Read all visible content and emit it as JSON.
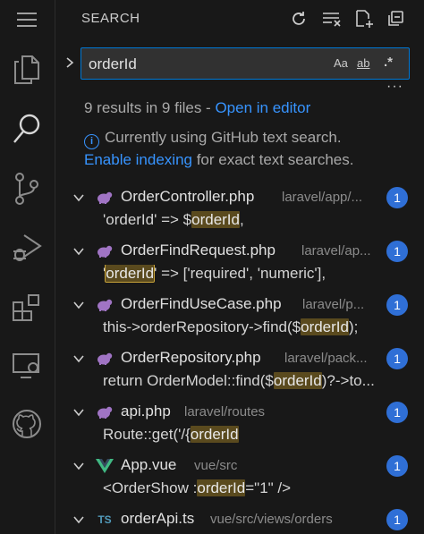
{
  "activity_bar": {
    "items": [
      {
        "name": "explorer",
        "icon": "files-icon"
      },
      {
        "name": "search",
        "icon": "search-icon",
        "active": true
      },
      {
        "name": "source-control",
        "icon": "source-control-icon"
      },
      {
        "name": "run-debug",
        "icon": "run-debug-icon"
      },
      {
        "name": "extensions",
        "icon": "extensions-icon"
      },
      {
        "name": "remote-explorer",
        "icon": "remote-explorer-icon"
      },
      {
        "name": "github",
        "icon": "github-icon"
      }
    ]
  },
  "header": {
    "title": "SEARCH",
    "actions": [
      "refresh-icon",
      "clear-results-icon",
      "new-search-editor-icon",
      "collapse-all-icon"
    ]
  },
  "search": {
    "value": "orderId",
    "options": {
      "match_case": "Aa",
      "whole_word": "ab",
      "regex": ".*"
    }
  },
  "summary": {
    "count_text": "9 results in 9 files - ",
    "open_in_editor": "Open in editor"
  },
  "info": {
    "line1": "Currently using GitHub text search.",
    "enable_indexing": "Enable indexing",
    "line2_rest": " for exact text searches."
  },
  "colors": {
    "accent": "#3794ff",
    "badge": "#2f6fd6",
    "php": "#a074c4",
    "vue": "#41b883",
    "ts": "#519aba",
    "match_highlight": "#5a4a1e"
  },
  "results": [
    {
      "file": "OrderController.php",
      "path": "laravel/app/...",
      "count": "1",
      "type": "php",
      "match": {
        "before": "'orderId' => $",
        "hit": "orderId",
        "after": ","
      }
    },
    {
      "file": "OrderFindRequest.php",
      "path": "laravel/ap...",
      "count": "1",
      "type": "php",
      "match": {
        "before": "'",
        "hit": "orderId",
        "after": "' => ['required', 'numeric'],"
      }
    },
    {
      "file": "OrderFindUseCase.php",
      "path": "laravel/p...",
      "count": "1",
      "type": "php",
      "match": {
        "before": "this->orderRepository->find($",
        "hit": "orderId",
        "after": ");"
      }
    },
    {
      "file": "OrderRepository.php",
      "path": "laravel/pack...",
      "count": "1",
      "type": "php",
      "match": {
        "before": "return OrderModel::find($",
        "hit": "orderId",
        "after": ")?->to..."
      }
    },
    {
      "file": "api.php",
      "path": "laravel/routes",
      "count": "1",
      "type": "php",
      "match": {
        "before": "Route::get('/{",
        "hit": "orderId",
        "after": ""
      }
    },
    {
      "file": "App.vue",
      "path": "vue/src",
      "count": "1",
      "type": "vue",
      "match": {
        "before": "<OrderShow :",
        "hit": "orderId",
        "after": "=\"1\" />"
      }
    },
    {
      "file": "orderApi.ts",
      "path": "vue/src/views/orders",
      "count": "1",
      "type": "ts",
      "type_label": "TS"
    }
  ]
}
